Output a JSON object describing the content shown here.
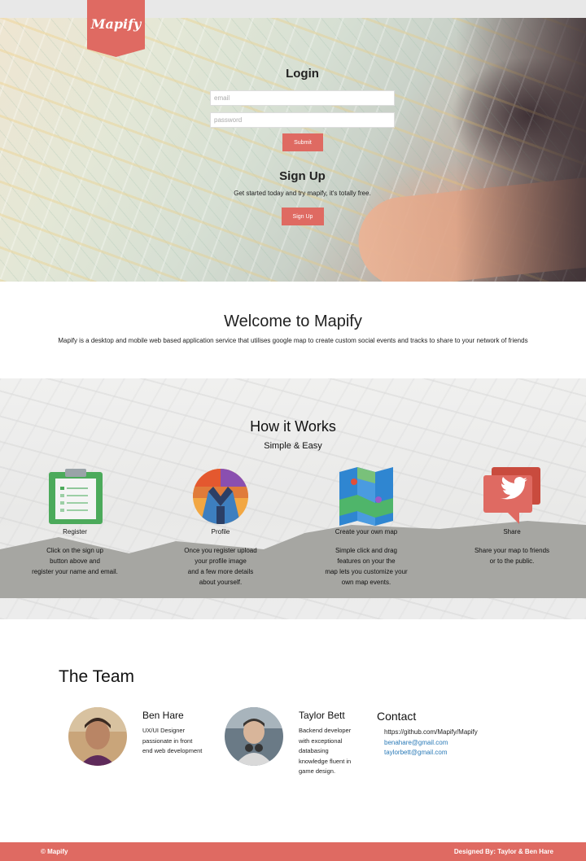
{
  "brand": {
    "logo_text": "Mapify"
  },
  "login": {
    "title": "Login",
    "email_placeholder": "email",
    "password_placeholder": "password",
    "submit_label": "Submit"
  },
  "signup": {
    "title": "Sign Up",
    "subtitle": "Get started today and try mapify, it's totally free.",
    "button_label": "Sign Up"
  },
  "welcome": {
    "title": "Welcome to Mapify",
    "text": "Mapify is a desktop and mobile web based application service that utilises google map to create custom social events and tracks to share to your network of friends"
  },
  "how": {
    "title": "How it Works",
    "subtitle": "Simple & Easy",
    "steps": [
      {
        "icon": "clipboard-icon",
        "label": "Register",
        "lines": [
          "Click on the sign up",
          "button above and",
          "register your name and email."
        ]
      },
      {
        "icon": "profile-icon",
        "label": "Profile",
        "lines": [
          "Once you register upload",
          "your profile image",
          "and a few more details",
          "about yourself."
        ]
      },
      {
        "icon": "map-icon",
        "label": "Create your own map",
        "lines": [
          "Simple click and drag",
          "features on your the",
          "map lets you customize your",
          "own map events."
        ]
      },
      {
        "icon": "twitter-share-icon",
        "label": "Share",
        "lines": [
          "Share your map to friends",
          "or to the public."
        ]
      }
    ]
  },
  "team": {
    "title": "The Team",
    "members": [
      {
        "name": "Ben Hare",
        "lines": [
          "UX/UI Designer",
          "passionate in front",
          "end web development"
        ]
      },
      {
        "name": "Taylor Bett",
        "lines": [
          "Backend developer",
          "with exceptional",
          "databasing",
          "knowledge fluent in",
          "game design."
        ]
      }
    ],
    "contact": {
      "title": "Contact",
      "github": "https://github.com/Mapify/Mapify",
      "email1": "benahare@gmail.com",
      "email2": "taylorbett@gmail.com"
    }
  },
  "footer": {
    "left": "© Mapify",
    "right": "Designed By: Taylor & Ben Hare"
  },
  "colors": {
    "accent": "#df6a62",
    "link": "#2a7ab7"
  }
}
